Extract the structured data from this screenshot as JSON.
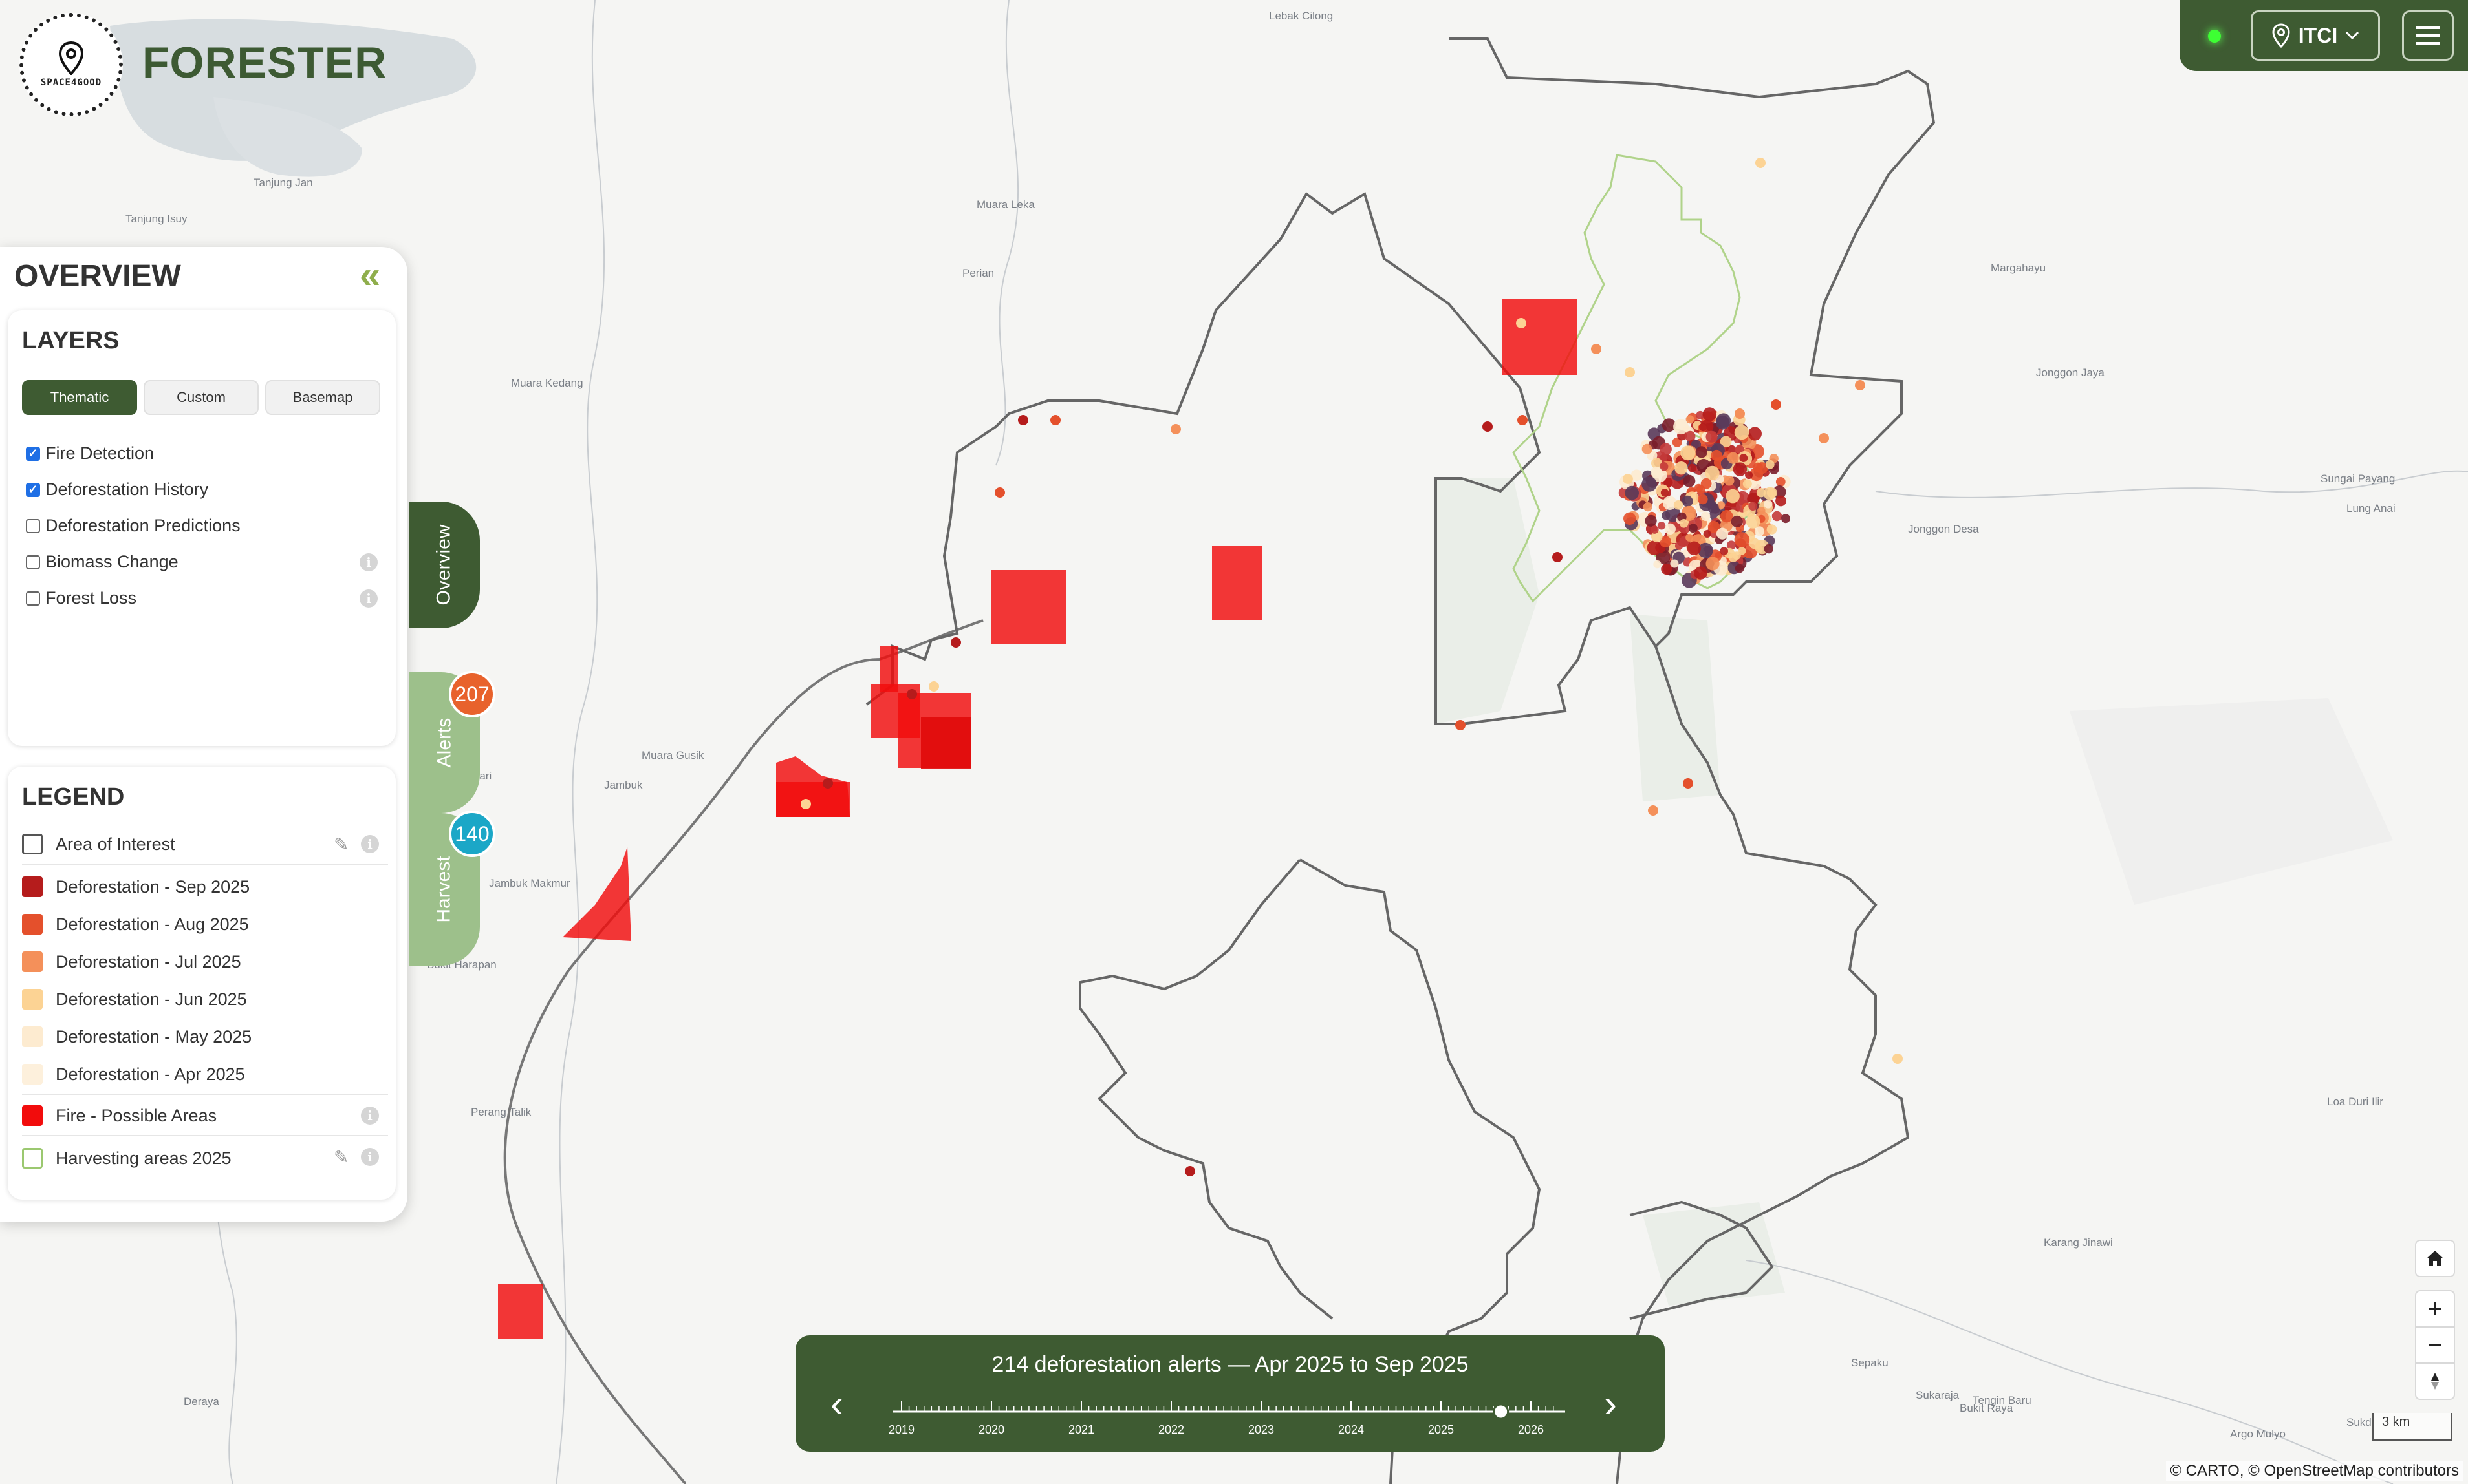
{
  "brand": {
    "logo_text": "SPACE4GOOD",
    "name": "FORESTER"
  },
  "topbar": {
    "status": "online",
    "region": "ITCI"
  },
  "panel": {
    "title": "OVERVIEW",
    "layers": {
      "title": "LAYERS",
      "tabs": [
        {
          "label": "Thematic",
          "active": true
        },
        {
          "label": "Custom",
          "active": false
        },
        {
          "label": "Basemap",
          "active": false
        }
      ],
      "items": [
        {
          "label": "Fire Detection",
          "checked": true
        },
        {
          "label": "Deforestation History",
          "checked": true
        },
        {
          "label": "Deforestation Predictions",
          "checked": false
        },
        {
          "label": "Biomass Change",
          "checked": false
        },
        {
          "label": "Forest Loss",
          "checked": false
        }
      ]
    },
    "legend": {
      "title": "LEGEND",
      "items": [
        {
          "label": "Area of Interest",
          "color": "#ffffff",
          "border": "#555555"
        },
        {
          "label": "Deforestation - Sep 2025",
          "color": "#b51c1c"
        },
        {
          "label": "Deforestation - Aug 2025",
          "color": "#e4502c"
        },
        {
          "label": "Deforestation - Jul 2025",
          "color": "#f4905a"
        },
        {
          "label": "Deforestation - Jun 2025",
          "color": "#fcd394"
        },
        {
          "label": "Deforestation - May 2025",
          "color": "#fdebd0"
        },
        {
          "label": "Deforestation - Apr 2025",
          "color": "#fdf0dc"
        },
        {
          "label": "Fire - Possible Areas",
          "color": "#f20c0c"
        },
        {
          "label": "Harvesting areas 2025",
          "color": "#ffffff",
          "border": "#9bc870"
        }
      ]
    }
  },
  "side_tabs": {
    "overview": "Overview",
    "alerts": "Alerts",
    "alerts_count": "207",
    "harvest": "Harvest",
    "harvest_count": "140"
  },
  "timeline": {
    "title": "214 deforestation alerts — Apr 2025 to Sep 2025",
    "prev": "‹",
    "next": "›",
    "years": [
      "2019",
      "2020",
      "2021",
      "2022",
      "2023",
      "2024",
      "2025",
      "2026"
    ],
    "selected_position": "Sep 2025"
  },
  "map": {
    "places": [
      "Lebak Cilong",
      "Tanjung Isuy",
      "Tanjung Jan",
      "Muara Leka",
      "Perian",
      "Muara Kedang",
      "Margahayu",
      "Jonggon Jaya",
      "Jonggon Desa",
      "Sungai Payang",
      "Lung Anai",
      "Muara Gusik",
      "Jambuk",
      "Sari",
      "Jambuk Makmur",
      "Bukit Harapan",
      "Perang Talik",
      "Loa Duri Ilir",
      "Karang Jinawi",
      "Sepaku",
      "Sukaraja",
      "Tengin Baru",
      "Bukit Raya",
      "Argo Mulyo",
      "Deraya",
      "Sukd"
    ],
    "scale_label": "3 km",
    "attribution": "© CARTO, © OpenStreetMap contributors"
  },
  "colors": {
    "accent": "#3e5b32",
    "alerts_badge": "#e8622c",
    "harvest_badge": "#1ba7c7"
  }
}
